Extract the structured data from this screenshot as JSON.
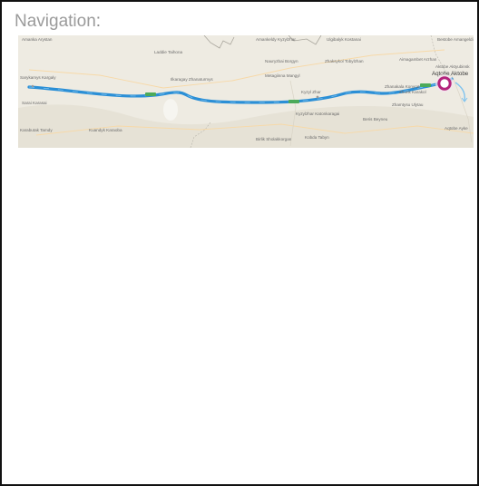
{
  "header": {
    "title": "Navigation",
    "colon": ":"
  },
  "map": {
    "labels": [
      "Amanka Arystan",
      "Laddie Taihona",
      "Amankeldy Kyzylzhar",
      "Ulgibalyk Kostanai",
      "Bestobe Amangeldi",
      "Nauryzbai Borgyn",
      "Zhaksykol Tobylzhan",
      "Aimagambet Arzhan",
      "Metagiinna Mangyl",
      "Ilkaragay Zhanaturmys",
      "Kyzyl Zhar",
      "Kyzylzhar Katonkaragai",
      "Zhanakala Konyrat",
      "Zhamtysu Ulytau",
      "Aktobe Aktyubinsk",
      "Sarykamys Kargaly",
      "Sarai Karasai",
      "Karabutak Tamdy",
      "Kuandyk Karaoba",
      "Birlik Sholakkorgan",
      "Beris Beyneu",
      "Kobda Tabyn",
      "Aqtobe Ayke",
      "Zhurik Karakol"
    ],
    "destination_label": "Aqtobe Aktobe",
    "route_color": "#2b8fd6",
    "marker_color": "#b3237c"
  }
}
